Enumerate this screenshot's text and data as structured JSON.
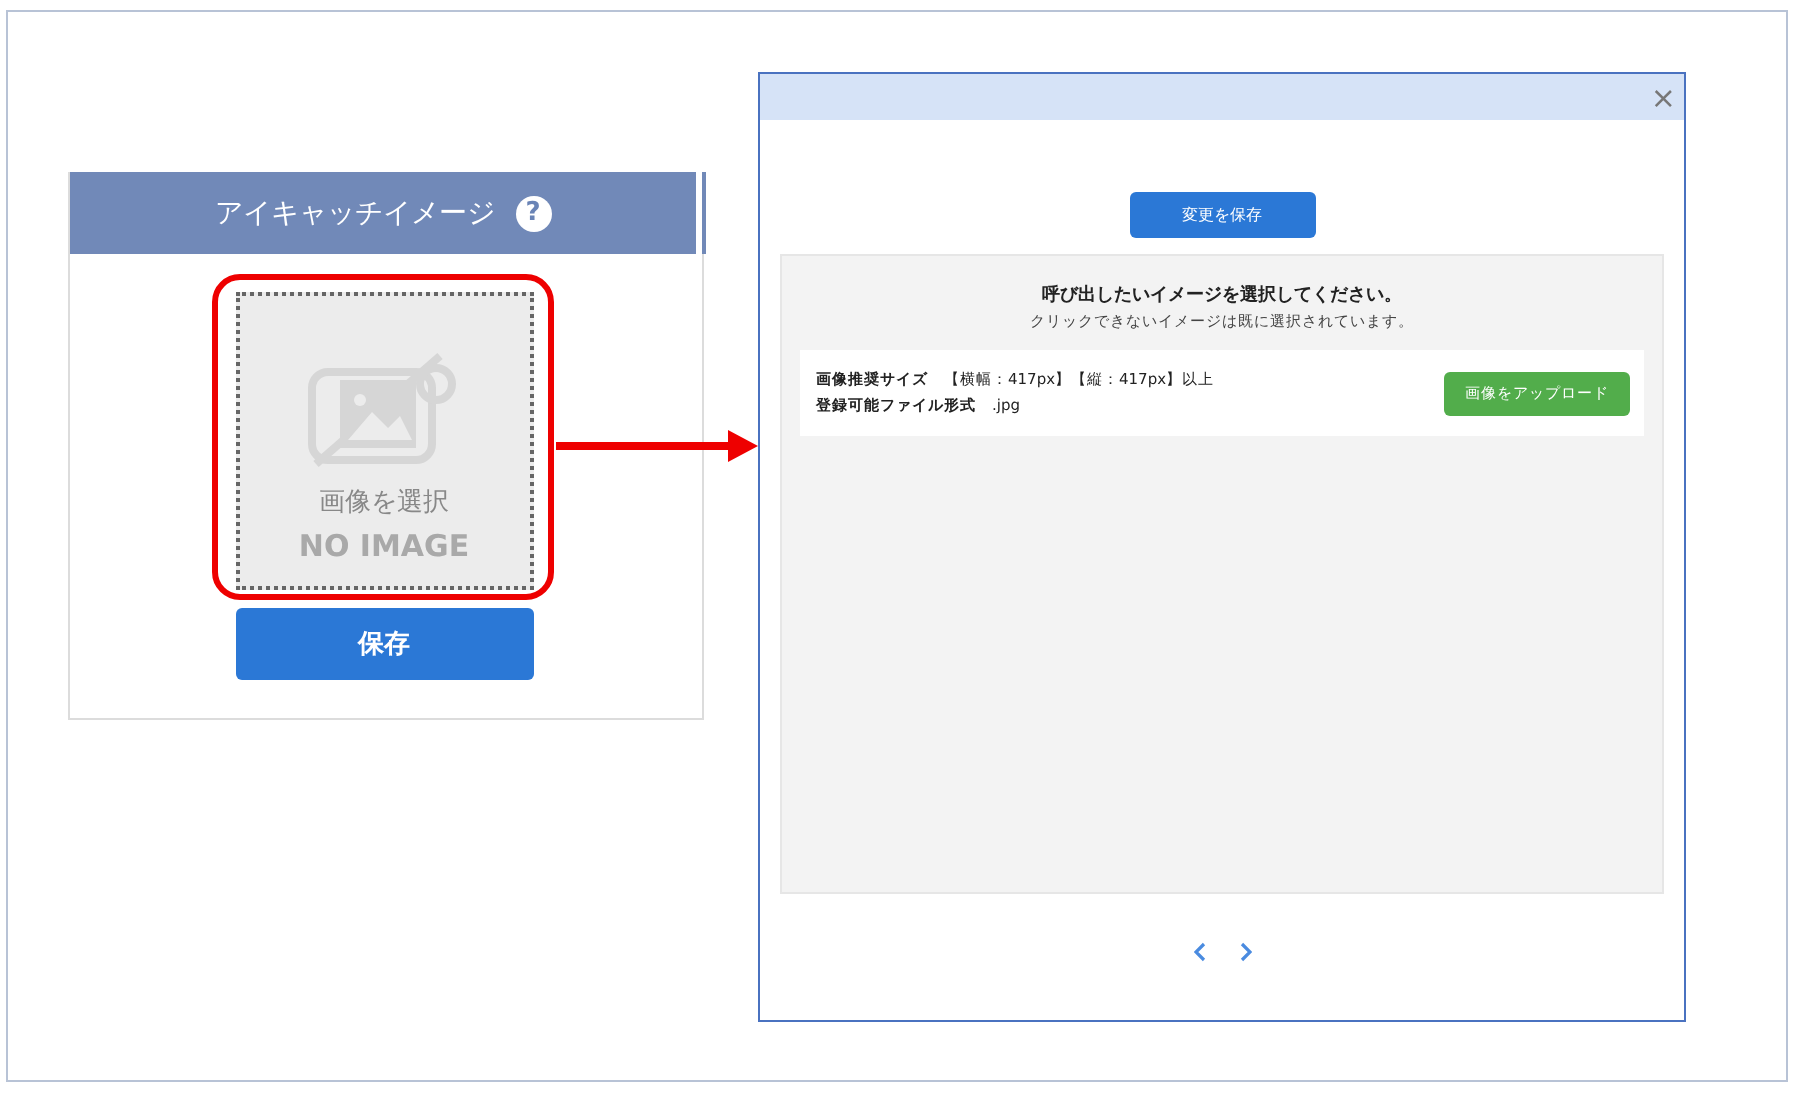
{
  "panel": {
    "title": "アイキャッチイメージ",
    "help": "?",
    "placeholder": {
      "label": "画像を選択",
      "watermark": "NO IMAGE"
    },
    "save_button": "保存"
  },
  "modal": {
    "close": "×",
    "save_button": "変更を保存",
    "prompt": "呼び出したいイメージを選択してください。",
    "note": "クリックできないイメージは既に選択されています。",
    "info": [
      {
        "label": "画像推奨サイズ",
        "value": "【横幅：417px】【縦：417px】以上"
      },
      {
        "label": "登録可能ファイル形式",
        "value": ".jpg"
      }
    ],
    "upload_button": "画像をアップロード"
  }
}
